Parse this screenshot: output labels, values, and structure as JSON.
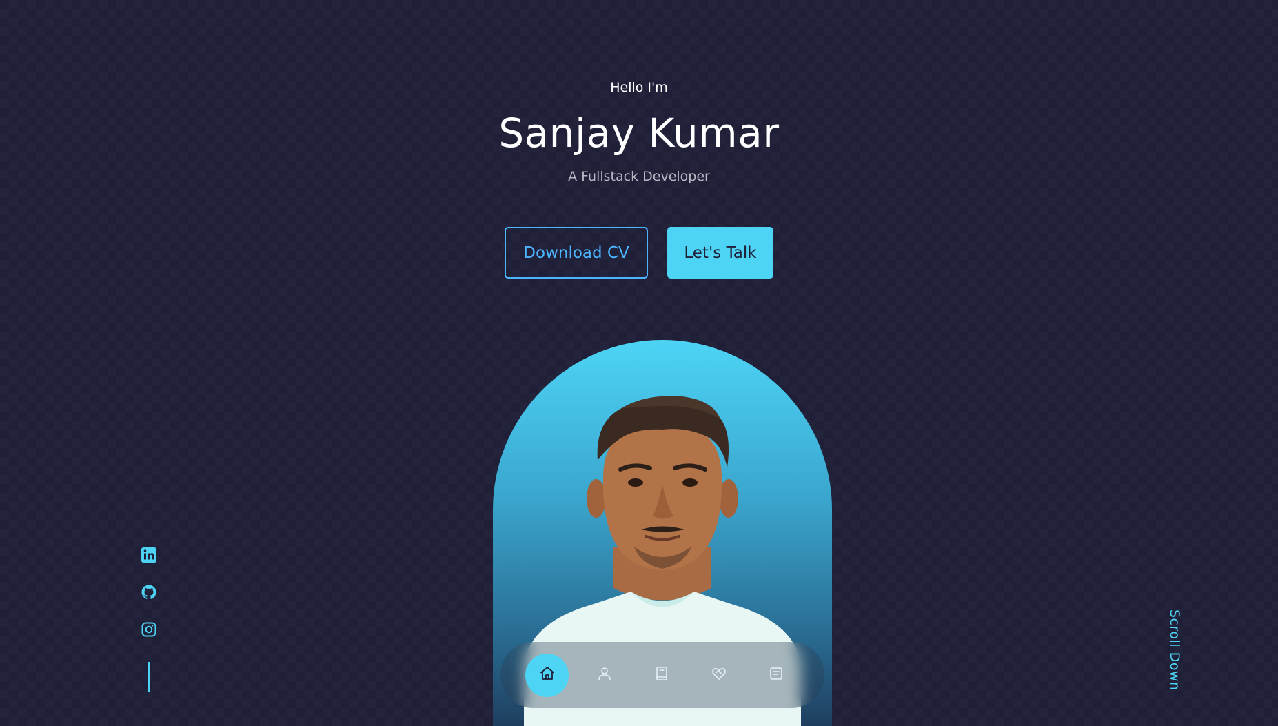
{
  "hero": {
    "greeting": "Hello I'm",
    "name": "Sanjay Kumar",
    "role": "A Fullstack Developer"
  },
  "cta": {
    "download_label": "Download CV",
    "talk_label": "Let's Talk"
  },
  "photo": {
    "icon": "portrait-photo"
  },
  "nav": {
    "items": [
      {
        "icon": "home-icon",
        "active": true
      },
      {
        "icon": "user-icon",
        "active": false
      },
      {
        "icon": "book-icon",
        "active": false
      },
      {
        "icon": "heart-handshake-icon",
        "active": false
      },
      {
        "icon": "message-icon",
        "active": false
      }
    ]
  },
  "socials": {
    "items": [
      {
        "icon": "linkedin-icon"
      },
      {
        "icon": "github-icon"
      },
      {
        "icon": "instagram-icon"
      }
    ]
  },
  "scroll": {
    "label": "Scroll Down"
  },
  "colors": {
    "background": "#1f1f38",
    "accent": "#4dd4f5",
    "text": "#ffffff",
    "muted": "#b9b9c6"
  }
}
